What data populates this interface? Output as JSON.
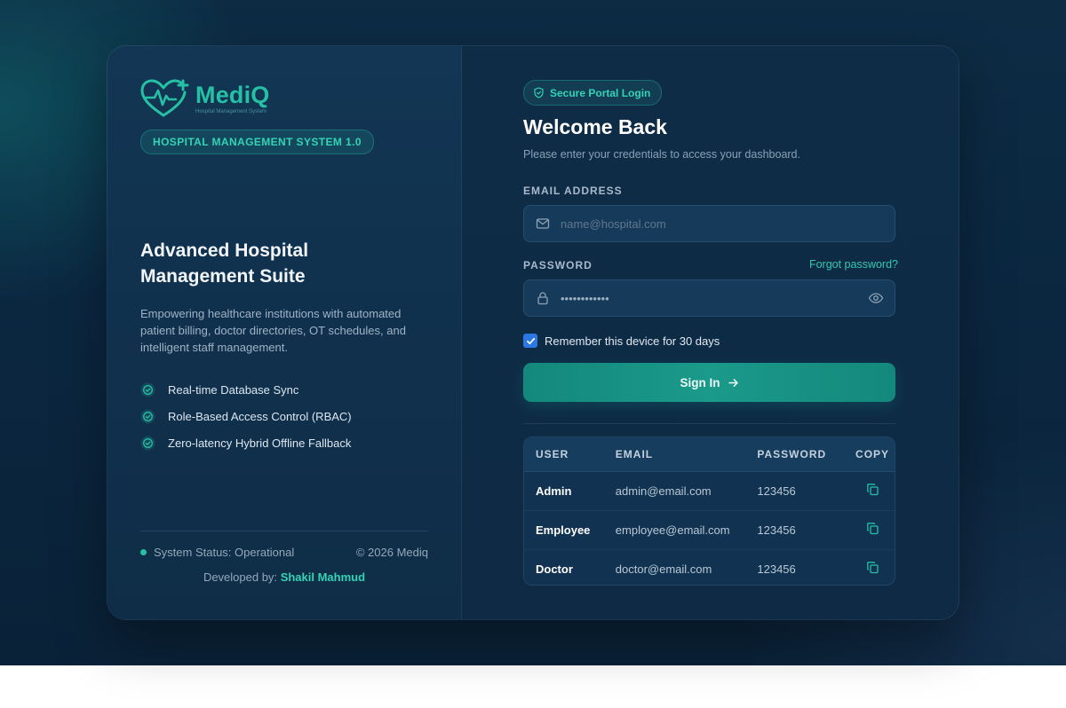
{
  "brand": {
    "name": "MediQ",
    "tagline": "Hospital Management System",
    "system_badge": "HOSPITAL MANAGEMENT SYSTEM 1.0"
  },
  "hero": {
    "title": "Advanced Hospital Management Suite",
    "description": "Empowering healthcare institutions with automated patient billing, doctor directories, OT schedules, and intelligent staff management.",
    "features": [
      {
        "label": "Real-time Database Sync",
        "icon": "check-circle-icon"
      },
      {
        "label": "Role-Based Access Control (RBAC)",
        "icon": "check-circle-icon"
      },
      {
        "label": "Zero-latency Hybrid Offline Fallback",
        "icon": "check-circle-icon"
      }
    ]
  },
  "footer": {
    "status": "System Status: Operational",
    "copyright": "© 2026 Mediq",
    "developed_by": "Developed by:",
    "developer": "Shakil Mahmud"
  },
  "login": {
    "badge": "Secure Portal Login",
    "title": "Welcome Back",
    "subtitle": "Please enter your credentials to access your dashboard.",
    "email_label": "EMAIL ADDRESS",
    "email_placeholder": "name@hospital.com",
    "email_value": "",
    "password_label": "PASSWORD",
    "password_value": "••••••••••••",
    "forgot": "Forgot password?",
    "remember": "Remember this device for 30 days",
    "remember_checked": true,
    "signin": "Sign In"
  },
  "credentials": {
    "headers": {
      "user": "USER",
      "email": "EMAIL",
      "password": "PASSWORD",
      "copy": "COPY"
    },
    "rows": [
      {
        "user": "Admin",
        "email": "admin@email.com",
        "password": "123456"
      },
      {
        "user": "Employee",
        "email": "employee@email.com",
        "password": "123456"
      },
      {
        "user": "Doctor",
        "email": "doctor@email.com",
        "password": "123456"
      }
    ]
  },
  "colors": {
    "accent": "#26c0a4",
    "primary_button": "#1a9a8a",
    "background": "#0b2740",
    "checkbox": "#2b78e4"
  }
}
